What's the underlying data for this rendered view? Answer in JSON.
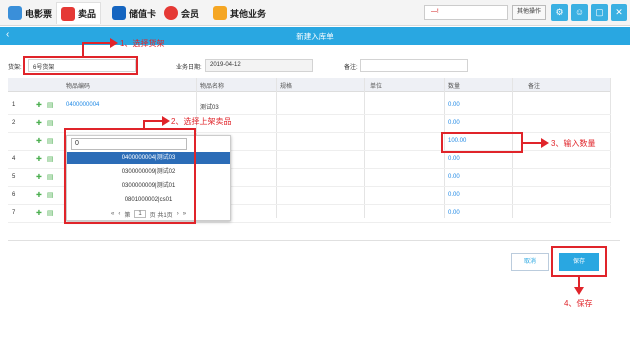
{
  "nav": {
    "tabs": [
      {
        "label": "电影票",
        "icon": "film-icon",
        "color": "#3a8fd9"
      },
      {
        "label": "卖品",
        "icon": "popcorn-icon",
        "color": "#e53935"
      },
      {
        "label": "储值卡",
        "icon": "card-icon",
        "color": "#1565c0"
      },
      {
        "label": "会员",
        "icon": "heart-icon",
        "color": "#e53935"
      },
      {
        "label": "其他业务",
        "icon": "misc-icon",
        "color": "#f5a623"
      }
    ],
    "search_value": "—!",
    "other_button": "其他操作"
  },
  "page": {
    "back": "‹",
    "title": "新建入库单"
  },
  "form": {
    "shelf_label": "货架:",
    "shelf_value": "6号货架",
    "date_label": "业务日期:",
    "date_value": "2019-04-12",
    "note_label": "备注:",
    "note_value": ""
  },
  "table": {
    "headers": [
      "物品编码",
      "物品名称",
      "规格",
      "单位",
      "数量",
      "备注"
    ],
    "rows": [
      {
        "no": "1",
        "code": "0400000004",
        "name": "测试03",
        "qty": "0.00"
      },
      {
        "no": "2",
        "code": "",
        "name": "",
        "qty": "0.00"
      },
      {
        "no": "",
        "code": "",
        "name": "",
        "qty": "100.00"
      },
      {
        "no": "4",
        "code": "",
        "name": "",
        "qty": "0.00"
      },
      {
        "no": "5",
        "code": "",
        "name": "",
        "qty": "0.00"
      },
      {
        "no": "6",
        "code": "",
        "name": "",
        "qty": "0.00"
      },
      {
        "no": "7",
        "code": "",
        "name": "",
        "qty": "0.00"
      }
    ]
  },
  "dropdown": {
    "input": "0",
    "items": [
      "0400000004|测试03",
      "0300000009|测试02",
      "0300000009|测试01",
      "0801000002|cs01"
    ],
    "pager": {
      "first": "«",
      "prev": "‹",
      "page_prefix": "第",
      "page": "1",
      "page_suffix": "页 共1页",
      "next": "›",
      "last": "»"
    }
  },
  "buttons": {
    "cancel": "取消",
    "save": "保存"
  },
  "annotations": {
    "step1": "1、选择货架",
    "step2": "2、选择上架卖品",
    "step3": "3、输入数量",
    "step4": "4、保存"
  },
  "colors": {
    "accent": "#29a7e1",
    "callout": "#e0242a"
  }
}
